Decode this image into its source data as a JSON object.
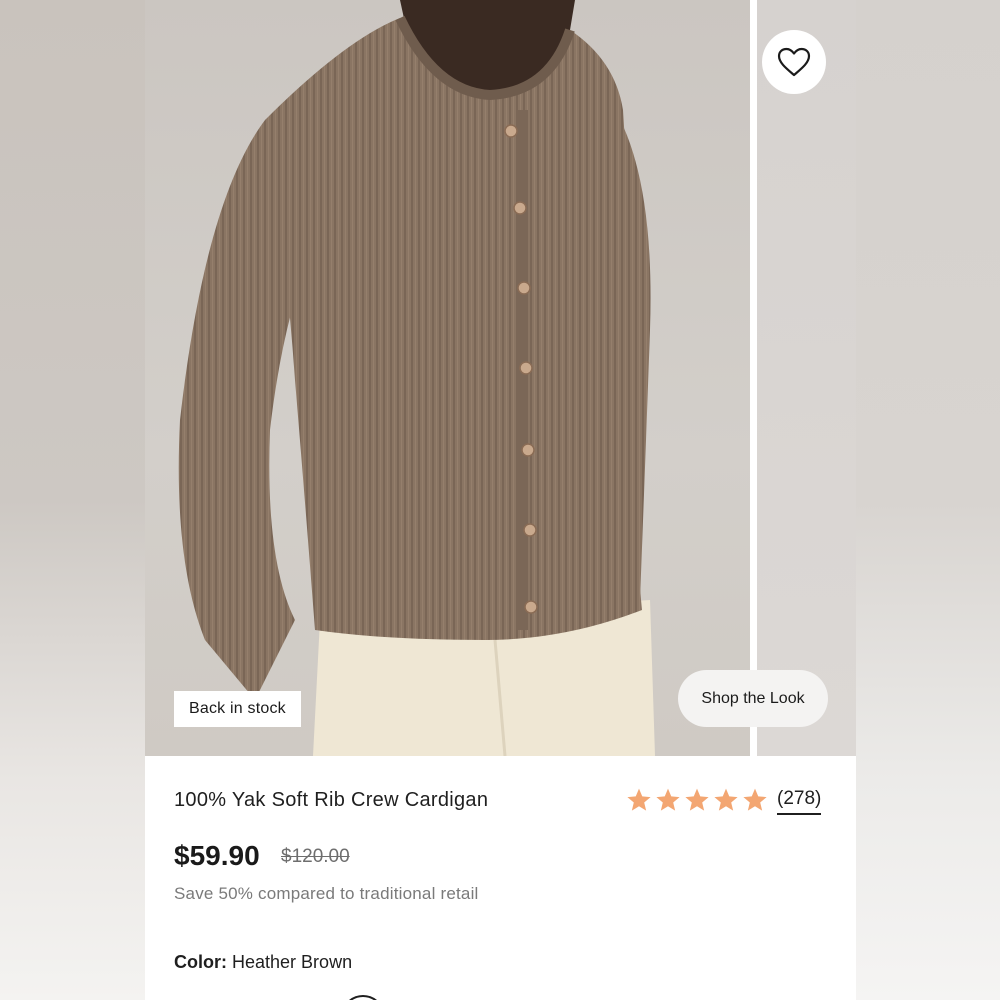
{
  "gallery": {
    "badge": "Back in stock",
    "shop_the_look": "Shop the Look"
  },
  "product": {
    "title": "100% Yak Soft Rib Crew Cardigan",
    "rating": 5,
    "rating_max": 5,
    "review_count": "(278)",
    "price": "$59.90",
    "original_price": "$120.00",
    "savings_text": "Save 50% compared to traditional retail",
    "color_label": "Color:",
    "color_value": "Heather Brown"
  },
  "colors": {
    "star": "#f3a672",
    "cardigan": "#8a7563",
    "trousers": "#efe7d4",
    "skin": "#3a2a22"
  },
  "icons": {
    "wishlist": "heart-outline-icon",
    "rating": "star-filled-icon"
  }
}
